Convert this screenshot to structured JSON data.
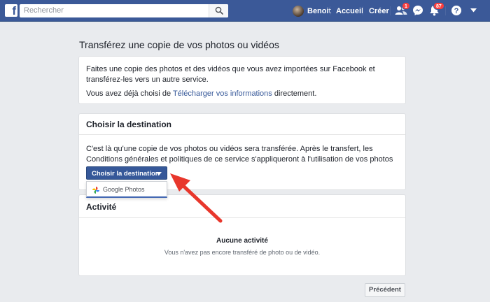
{
  "header": {
    "search_placeholder": "Rechercher",
    "user_name": "Benoit",
    "home_label": "Accueil",
    "create_label": "Créer",
    "friend_badge": "1",
    "notif_badge": "87"
  },
  "page": {
    "title": "Transférez une copie de vos photos ou vidéos"
  },
  "intro": {
    "line1": "Faites une copie des photos et des vidéos que vous avez importées sur Facebook et transférez-les vers un autre service.",
    "line2_prefix": "Vous avez déjà choisi de ",
    "line2_link": "Télécharger vos informations",
    "line2_suffix": " directement."
  },
  "destination": {
    "heading": "Choisir la destination",
    "description": "C'est là qu'une copie de vos photos ou vidéos sera transférée. Après le transfert, les Conditions générales et politiques de ce service s'appliqueront à l'utilisation de vos photos et vidéos.",
    "button_label": "Choisir la destination",
    "options": [
      "Google Photos"
    ]
  },
  "activity": {
    "heading": "Activité",
    "empty_title": "Aucune activité",
    "empty_subtitle": "Vous n'avez pas encore transféré de photo ou de vidéo."
  },
  "footer": {
    "prev_label": "Précédent"
  },
  "colors": {
    "brand": "#3b5998",
    "button": "#365899",
    "arrow": "#e8372c"
  }
}
